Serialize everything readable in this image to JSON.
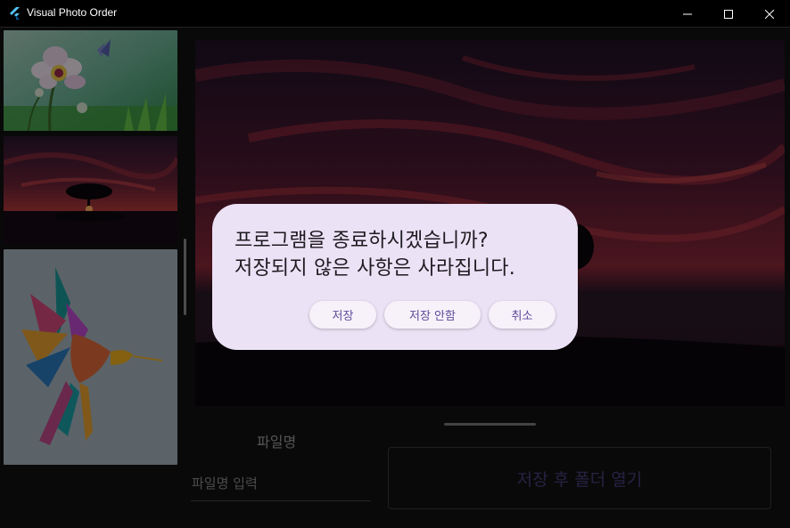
{
  "window": {
    "title": "Visual Photo Order"
  },
  "thumbnails": [
    {
      "name": "flower-butterfly"
    },
    {
      "name": "sunset-tree"
    },
    {
      "name": "colorful-hummingbird"
    }
  ],
  "form": {
    "filename_label": "파일명",
    "filename_placeholder": "파일명 입력",
    "save_open_label": "저장 후 폴더 열기"
  },
  "dialog": {
    "line1": "프로그램을 종료하시겠습니까?",
    "line2": "저장되지 않은 사항은 사라집니다.",
    "save": "저장",
    "dont_save": "저장 안함",
    "cancel": "취소"
  },
  "colors": {
    "accent": "#463e7a",
    "dialog_bg": "#ece2f6",
    "dialog_button_text": "#5e4b9a"
  }
}
